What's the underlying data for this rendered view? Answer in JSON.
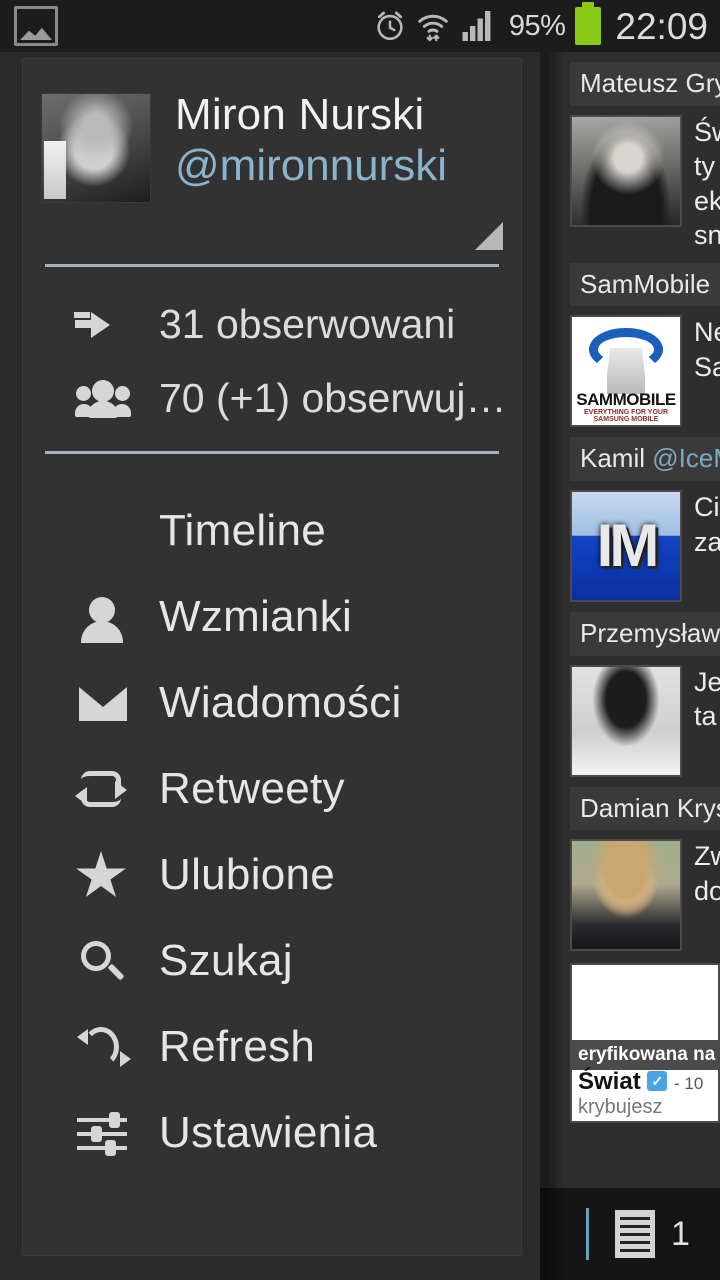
{
  "statusbar": {
    "notification_icon": "gallery-image-icon",
    "alarm_icon": "alarm-clock-icon",
    "wifi_icon": "wifi-icon",
    "signal_icon": "cell-signal-icon",
    "battery_percent": "95%",
    "battery_icon": "battery-full-icon",
    "clock": "22:09",
    "bg_color": "#1c1c1c"
  },
  "drawer": {
    "profile": {
      "name": "Miron Nurski",
      "handle": "@mironnurski",
      "avatar_icon": "user-avatar",
      "expand_corner_icon": "corner-fold-icon",
      "handle_color": "#8bb4cc"
    },
    "divider_color": "#9fb3bd",
    "stats": [
      {
        "icon": "following-arrow-icon",
        "label": "31 obserwowani"
      },
      {
        "icon": "followers-group-icon",
        "label": "70 (+1) obserwuj…"
      }
    ],
    "menu": [
      {
        "icon": "timeline-list-icon",
        "label": "Timeline"
      },
      {
        "icon": "person-icon",
        "label": "Wzmianki"
      },
      {
        "icon": "envelope-icon",
        "label": "Wiadomości"
      },
      {
        "icon": "retweet-icon",
        "label": "Retweety"
      },
      {
        "icon": "star-icon",
        "label": "Ulubione"
      },
      {
        "icon": "search-icon",
        "label": "Szukaj"
      },
      {
        "icon": "refresh-icon",
        "label": "Refresh"
      },
      {
        "icon": "settings-sliders-icon",
        "label": "Ustawienia"
      }
    ]
  },
  "timeline": {
    "tweets": [
      {
        "author": "Mateusz Gry",
        "handle": "",
        "avatar": "mateusz-avatar",
        "text": "Św\nty\nek\nsn"
      },
      {
        "author": "SamMobile",
        "handle": "",
        "avatar": "sammobile-logo",
        "logo_text": "SAMMOBILE",
        "logo_tagline": "EVERYTHING FOR YOUR SAMSUNG MOBILE",
        "text": "Ne\nSa"
      },
      {
        "author": "Kamil",
        "handle": "@IceM",
        "avatar": "kamil-im-logo",
        "logo_text": "IM",
        "text": "Ci\nza"
      },
      {
        "author": "Przemysław",
        "handle": "",
        "avatar": "przemyslaw-avatar",
        "text": "Je\nta"
      },
      {
        "author": "Damian Krys",
        "handle": "",
        "avatar": "damian-avatar",
        "text": "Zw\ndo"
      }
    ],
    "link_card": {
      "overlay_text": "eryfikowana na",
      "title": "Świat",
      "verified_icon": "verified-badge-icon",
      "date": "- 10",
      "footer": "krybujesz"
    }
  },
  "bottombar": {
    "accent_color": "#6d9fb5",
    "list_icon": "timeline-list-icon",
    "count": "1"
  }
}
